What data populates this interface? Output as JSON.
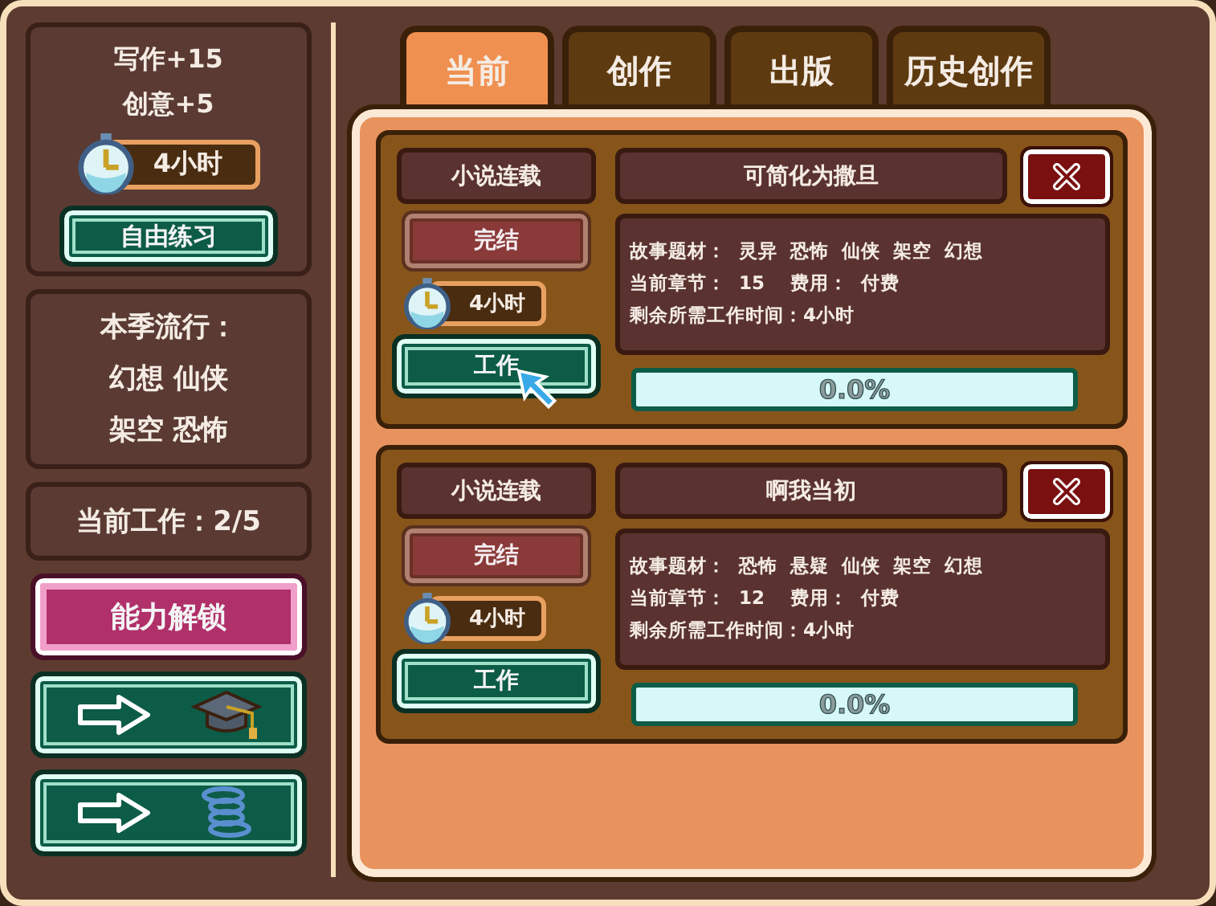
{
  "stats": [
    "写作+15",
    "创意+5"
  ],
  "practice": {
    "time": "4小时",
    "button": "自由练习"
  },
  "trend": {
    "title": "本季流行：",
    "lines": [
      "幻想 仙侠",
      "架空 恐怖"
    ]
  },
  "work_count": "当前工作：2/5",
  "unlock_button": "能力解锁",
  "nav_buttons": [
    {
      "kind": "cap"
    },
    {
      "kind": "spring"
    }
  ],
  "tabs": [
    {
      "label": "当前",
      "selected": true
    },
    {
      "label": "创作",
      "selected": false
    },
    {
      "label": "出版",
      "selected": false
    },
    {
      "label": "历史创作",
      "selected": false
    }
  ],
  "works": [
    {
      "type": "小说连载",
      "title": "可简化为撒旦",
      "finish": "完结",
      "time": "4小时",
      "work": "工作",
      "hovered": true,
      "lines": [
        "故事题材：  灵异  恐怖  仙侠  架空  幻想",
        "当前章节：  15    费用：  付费",
        "剩余所需工作时间：4小时"
      ],
      "reading": "0.0%"
    },
    {
      "type": "小说连载",
      "title": "啊我当初",
      "finish": "完结",
      "time": "4小时",
      "work": "工作",
      "hovered": false,
      "lines": [
        "故事题材：  恐怖  悬疑  仙侠  架空  幻想",
        "当前章节：  12    费用：  付费",
        "剩余所需工作时间：4小时"
      ],
      "reading": "0.0%"
    }
  ]
}
